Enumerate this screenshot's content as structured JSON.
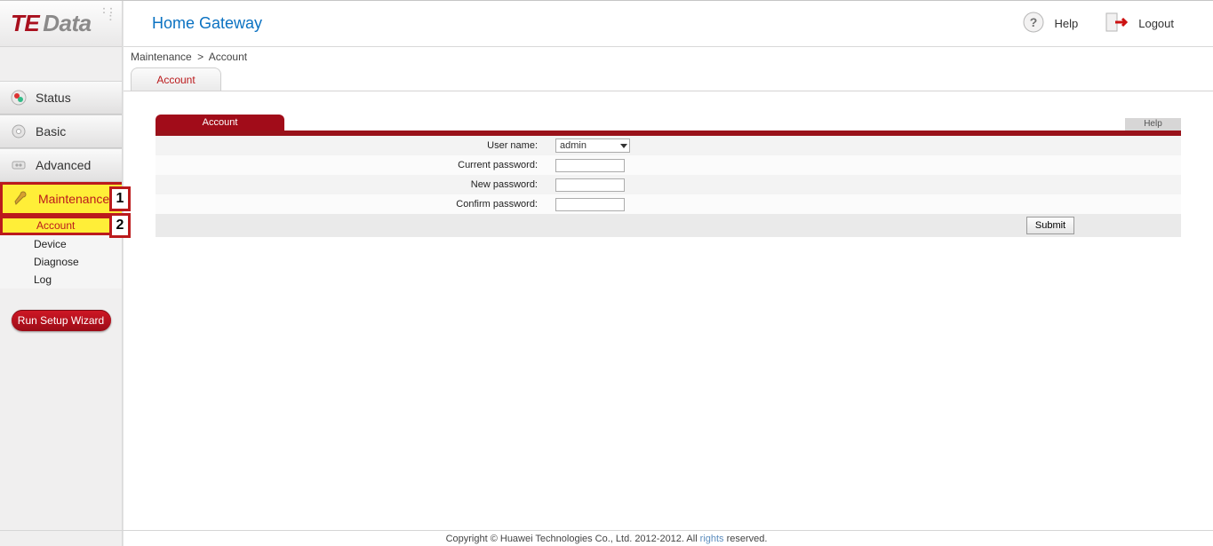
{
  "logo": {
    "part1": "TE",
    "part2": "Data"
  },
  "header": {
    "title": "Home Gateway",
    "help": "Help",
    "logout": "Logout"
  },
  "nav": {
    "status": "Status",
    "basic": "Basic",
    "advanced": "Advanced",
    "maintenance": "Maintenance",
    "sub": {
      "account": "Account",
      "device": "Device",
      "diagnose": "Diagnose",
      "log": "Log"
    },
    "wizard": "Run Setup Wizard"
  },
  "steps": {
    "one": "1",
    "two": "2"
  },
  "breadcrumb": {
    "a": "Maintenance",
    "sep": ">",
    "b": "Account"
  },
  "subtab": {
    "account": "Account"
  },
  "section": {
    "title": "Account",
    "help": "Help"
  },
  "form": {
    "username_label": "User name:",
    "username_value": "admin",
    "current_pw": "Current password:",
    "new_pw": "New password:",
    "confirm_pw": "Confirm password:"
  },
  "buttons": {
    "submit": "Submit"
  },
  "footer": {
    "pre": "Copyright © Huawei Technologies Co., Ltd. 2012-2012. All",
    "rights": "rights",
    "post": "reserved."
  }
}
